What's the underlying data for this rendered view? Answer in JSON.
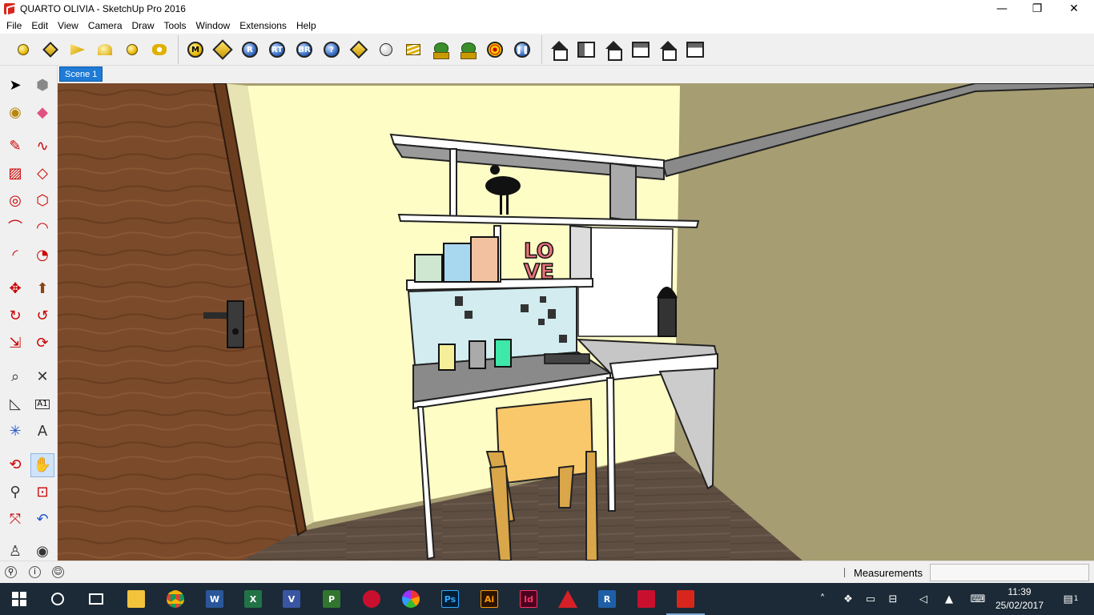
{
  "window": {
    "title": "QUARTO OLIVIA - SketchUp Pro 2016",
    "minimize_glyph": "—",
    "maximize_glyph": "❐",
    "close_glyph": "✕"
  },
  "menu": {
    "items": [
      "File",
      "Edit",
      "View",
      "Camera",
      "Draw",
      "Tools",
      "Window",
      "Extensions",
      "Help"
    ]
  },
  "toolbar": {
    "plugin_buttons": [
      {
        "icon": "m-icon",
        "label": "M"
      },
      {
        "icon": "tag-icon",
        "label": ""
      },
      {
        "icon": "r-icon",
        "label": "R"
      },
      {
        "icon": "rt-icon",
        "label": "RT"
      },
      {
        "icon": "br-icon",
        "label": "BR"
      },
      {
        "icon": "help-icon",
        "label": "?"
      }
    ]
  },
  "scenes": {
    "tabs": [
      "Scene 1"
    ]
  },
  "status": {
    "measurements_label": "Measurements",
    "measurements_value": ""
  },
  "taskbar": {
    "apps": [
      {
        "name": "word",
        "label": "W",
        "color": "#2b579a"
      },
      {
        "name": "excel",
        "label": "X",
        "color": "#217346"
      },
      {
        "name": "visio",
        "label": "V",
        "color": "#3955a3"
      },
      {
        "name": "project",
        "label": "P",
        "color": "#31752f"
      },
      {
        "name": "photoshop",
        "label": "Ps",
        "color": "#001d34"
      },
      {
        "name": "illustrator",
        "label": "Ai",
        "color": "#2e1200"
      },
      {
        "name": "indesign",
        "label": "Id",
        "color": "#49021f"
      }
    ],
    "time": "11:39",
    "date": "25/02/2017",
    "notification_count": "1"
  },
  "colors": {
    "selection_blue": "#1e7bd6",
    "wall_yellow": "#fffdc6",
    "wall_olive": "#a69d72",
    "door_wood": "#7a4a2a",
    "floor_wood": "#5e4e42",
    "chair_yellow": "#f9c86a",
    "taskbar_bg": "#1b2a36"
  }
}
